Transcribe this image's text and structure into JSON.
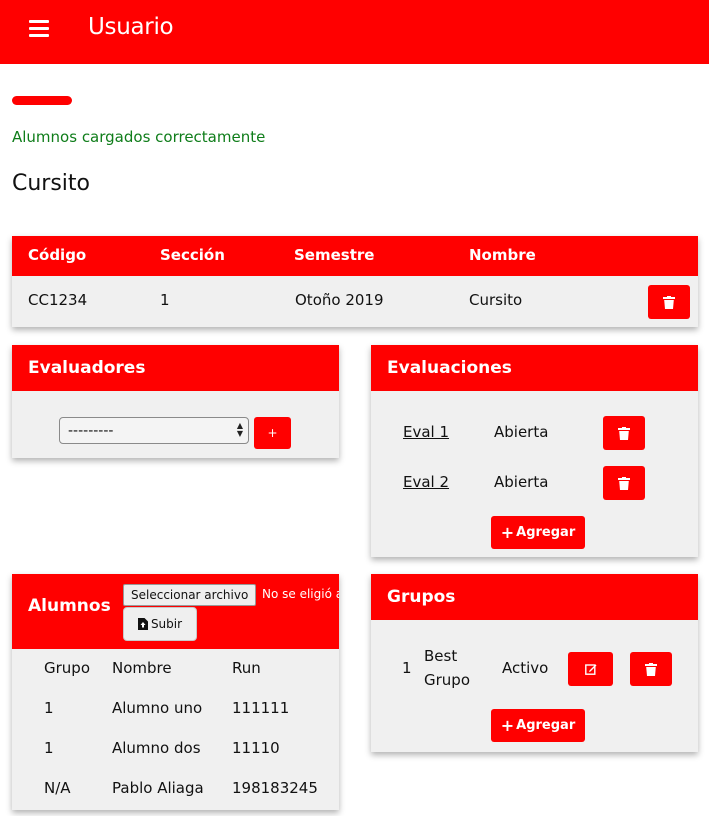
{
  "header": {
    "title": "Usuario",
    "menu_icon": "hamburger-menu-icon"
  },
  "flash_message": "Alumnos cargados correctamente",
  "course": {
    "title": "Cursito",
    "columns": [
      "Código",
      "Sección",
      "Semestre",
      "Nombre"
    ],
    "row": {
      "codigo": "CC1234",
      "seccion": "1",
      "semestre": "Otoño 2019",
      "nombre": "Cursito"
    }
  },
  "evaluadores": {
    "title": "Evaluadores",
    "select_value": "---------",
    "add_label": "+"
  },
  "evaluaciones": {
    "title": "Evaluaciones",
    "items": [
      {
        "name": "Eval 1",
        "status": "Abierta"
      },
      {
        "name": "Eval 2",
        "status": "Abierta"
      }
    ],
    "add_label": "Agregar"
  },
  "alumnos": {
    "title": "Alumnos",
    "file_button": "Seleccionar archivo",
    "file_status": "No se eligió archivo",
    "upload_label": "Subir",
    "columns": [
      "Grupo",
      "Nombre",
      "Run"
    ],
    "rows": [
      {
        "grupo": "1",
        "nombre": "Alumno uno",
        "run": "111111"
      },
      {
        "grupo": "1",
        "nombre": "Alumno dos",
        "run": "11110"
      },
      {
        "grupo": "N/A",
        "nombre": "Pablo Aliaga",
        "run": "198183245"
      }
    ]
  },
  "grupos": {
    "title": "Grupos",
    "items": [
      {
        "number": "1",
        "name_line1": "Best",
        "name_line2": "Grupo",
        "status": "Activo"
      }
    ],
    "add_label": "Agregar"
  },
  "colors": {
    "primary": "#ff0000",
    "success": "#0f7d1a",
    "card_bg": "#f0f0f0"
  }
}
